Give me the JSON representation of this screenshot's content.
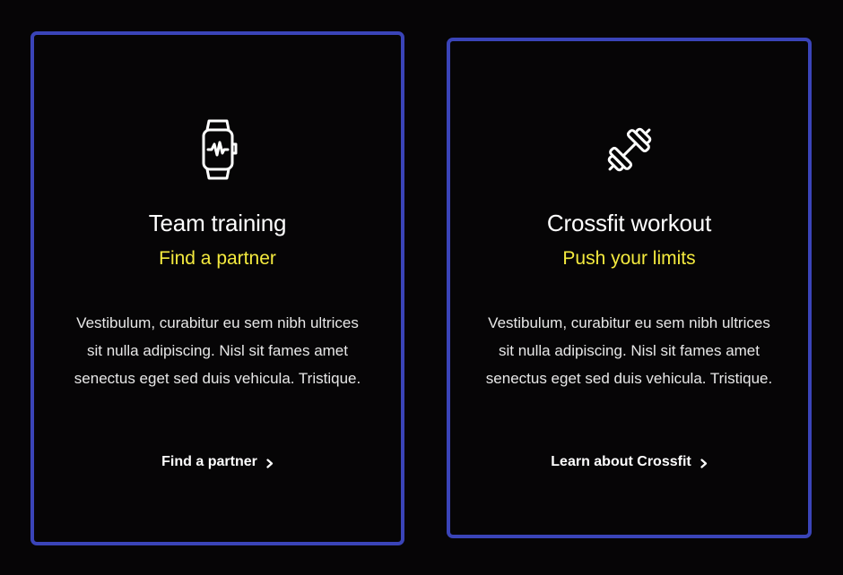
{
  "cards": [
    {
      "icon": "smartwatch-icon",
      "title": "Team training",
      "subtitle": "Find a partner",
      "body": "Vestibulum, curabitur eu sem nibh ultrices sit nulla adipiscing. Nisl sit fames amet senectus eget sed duis vehicula. Tristique.",
      "link_label": "Find a partner"
    },
    {
      "icon": "dumbbell-icon",
      "title": "Crossfit workout",
      "subtitle": "Push your limits",
      "body": "Vestibulum, curabitur eu sem nibh ultrices sit nulla adipiscing. Nisl sit fames amet senectus eget sed duis vehicula. Tristique.",
      "link_label": "Learn about Crossfit"
    }
  ],
  "colors": {
    "background": "#060506",
    "card_border": "#3a44b8",
    "accent": "#f4ea3e",
    "text": "#ffffff"
  }
}
